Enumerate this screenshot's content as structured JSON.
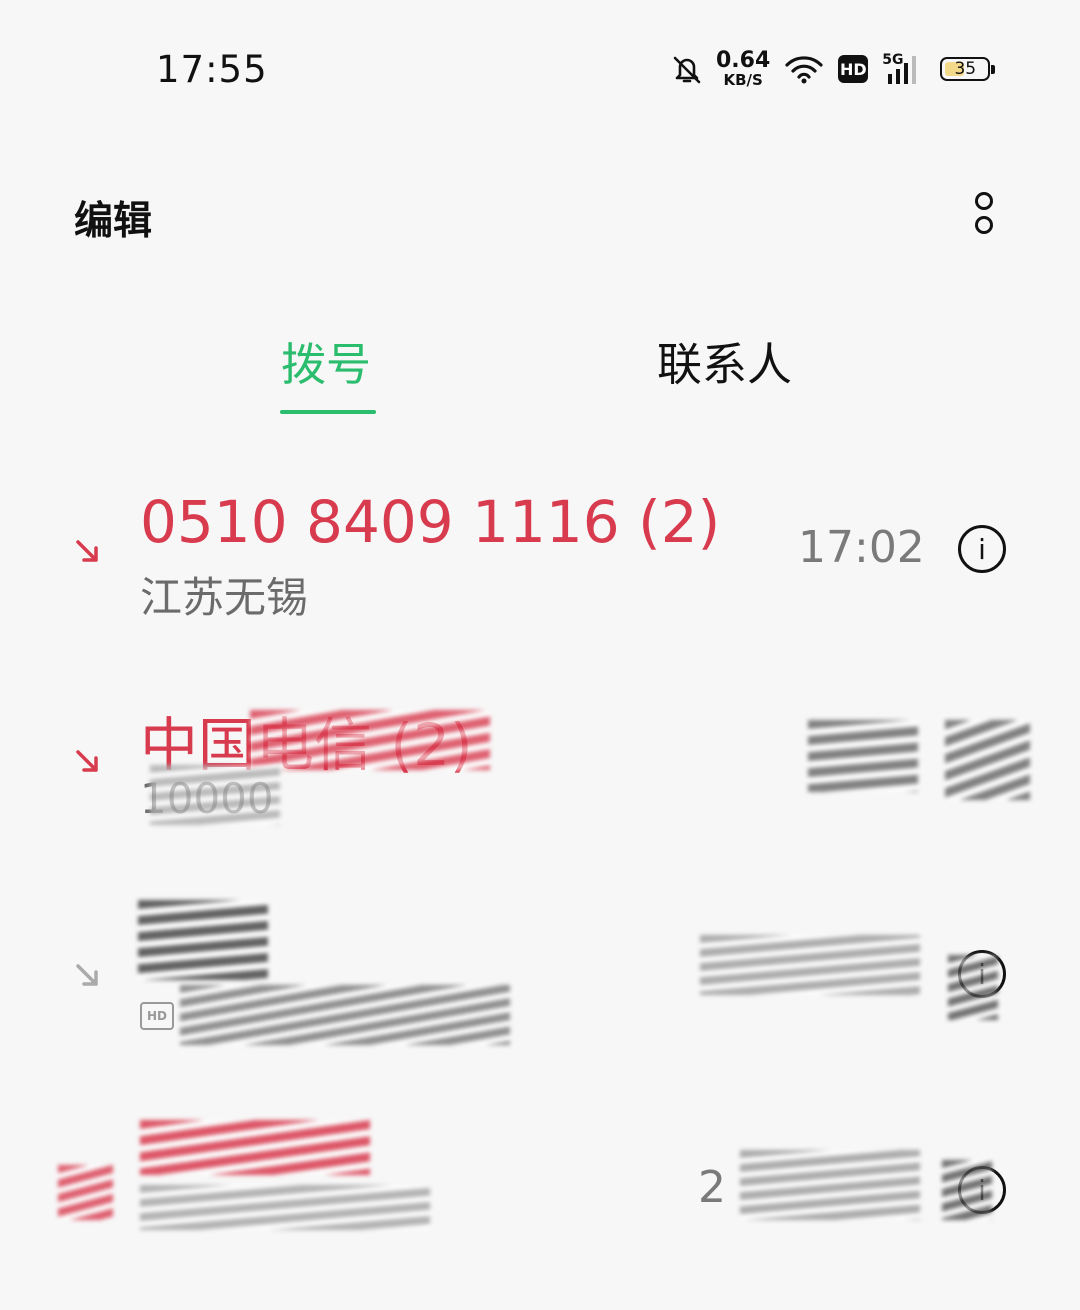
{
  "status_bar": {
    "time": "17:55",
    "net_speed_value": "0.64",
    "net_speed_unit": "KB/S",
    "hd": "HD",
    "network": "5G",
    "battery": "35",
    "icons": [
      "bell-muted-icon",
      "wifi-icon",
      "signal-icon",
      "battery-icon"
    ]
  },
  "header": {
    "edit_label": "编辑",
    "more_icon": "more-vertical-icon"
  },
  "tabs": [
    {
      "label": "拨号",
      "active": true
    },
    {
      "label": "联系人",
      "active": false
    }
  ],
  "calls": [
    {
      "title": "0510 8409 1116 (2)",
      "subtitle": "江苏无锡",
      "time": "17:02",
      "type": "missed"
    },
    {
      "title": "中国电信 (2)",
      "subtitle": "10000",
      "time": "",
      "type": "missed"
    },
    {
      "title": "",
      "subtitle": "",
      "time": "",
      "type": "incoming",
      "hd": "HD"
    },
    {
      "title": "",
      "subtitle": "",
      "time": "2",
      "type": "missed"
    }
  ],
  "colors": {
    "accent": "#2bbd6e",
    "missed": "#d83a4e",
    "secondary": "#6b6b6b"
  }
}
